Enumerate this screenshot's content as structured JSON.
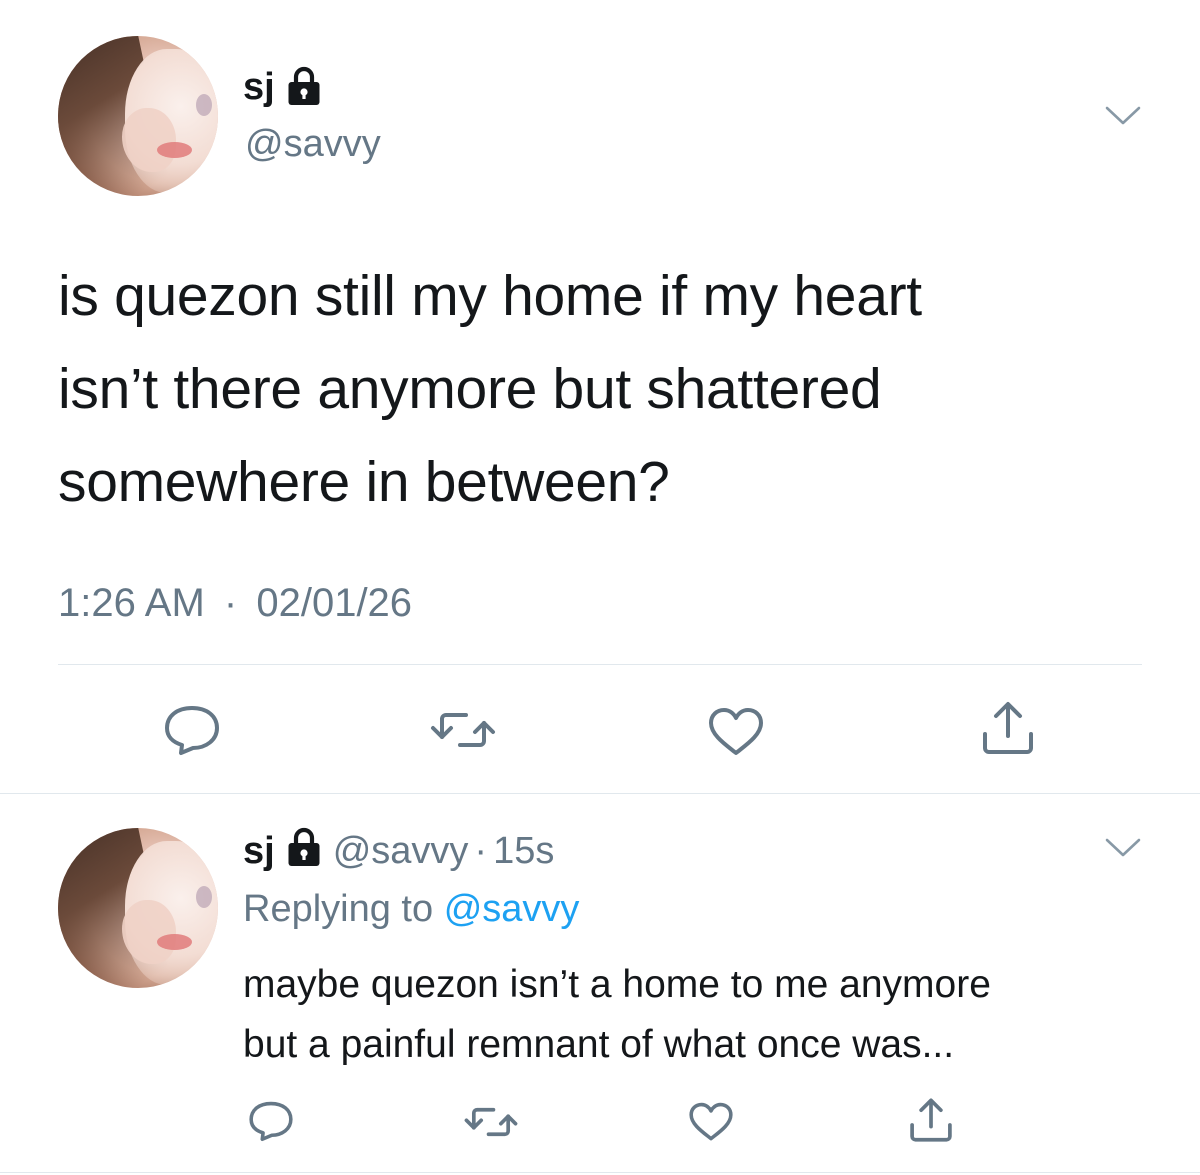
{
  "main_tweet": {
    "display_name": "sj",
    "handle": "@savvy",
    "text": "is quezon still my home if my heart\nisn’t there anymore but shattered\nsomewhere in between?",
    "time": "1:26 AM",
    "separator": "·",
    "date": "02/01/26",
    "icons": {
      "lock": "lock-icon",
      "menu": "chevron-down-icon",
      "reply": "reply-icon",
      "retweet": "retweet-icon",
      "like": "heart-icon",
      "share": "share-icon"
    }
  },
  "reply_tweet": {
    "display_name": "sj",
    "handle": "@savvy",
    "separator": "·",
    "age": "15s",
    "replying_prefix": "Replying to",
    "replying_handle": "@savvy",
    "text": "maybe quezon isn’t a home to me anymore\nbut a painful remnant of what once was..."
  },
  "colors": {
    "text": "#14171a",
    "secondary": "#657786",
    "link": "#1da1f2",
    "divider": "#e1e8ed"
  }
}
